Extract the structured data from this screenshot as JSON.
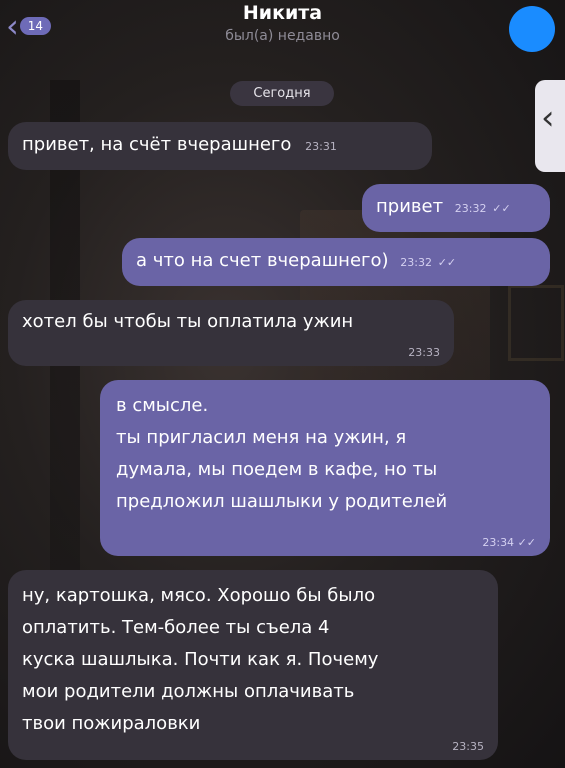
{
  "header": {
    "back_count": "14",
    "contact_name": "Никита",
    "status": "был(а) недавно"
  },
  "date_divider": "Сегодня",
  "messages": [
    {
      "direction": "in",
      "text": "привет, на счёт вчерашнего",
      "time": "23:31"
    },
    {
      "direction": "out",
      "text": "привет",
      "time": "23:32",
      "status": "read"
    },
    {
      "direction": "out",
      "text": "а что на счет вчерашнего)",
      "time": "23:32",
      "status": "read"
    },
    {
      "direction": "in",
      "text": "хотел бы чтобы ты оплатила ужин",
      "time": "23:33"
    },
    {
      "direction": "out",
      "lines": [
        "в смысле.",
        "ты пригласил меня на ужин, я",
        "думала, мы поедем в кафе, но ты",
        "предложил шашлыки у родителей"
      ],
      "time": "23:34",
      "status": "read"
    },
    {
      "direction": "in",
      "lines": [
        "ну, картошка, мясо. Хорошо бы было",
        "оплатить. Тем-более ты съела 4",
        "куска шашлыка. Почти как я. Почему",
        "мои родители должны оплачивать",
        "твои пожираловки"
      ],
      "time": "23:35"
    }
  ],
  "colors": {
    "outgoing": "#6a64a6",
    "incoming": "#36323b",
    "accent": "#8d89c9",
    "avatar": "#1a8cff"
  },
  "icons": {
    "back": "chevron-left-icon",
    "read": "double-check-icon",
    "panel": "chevron-left-icon"
  }
}
